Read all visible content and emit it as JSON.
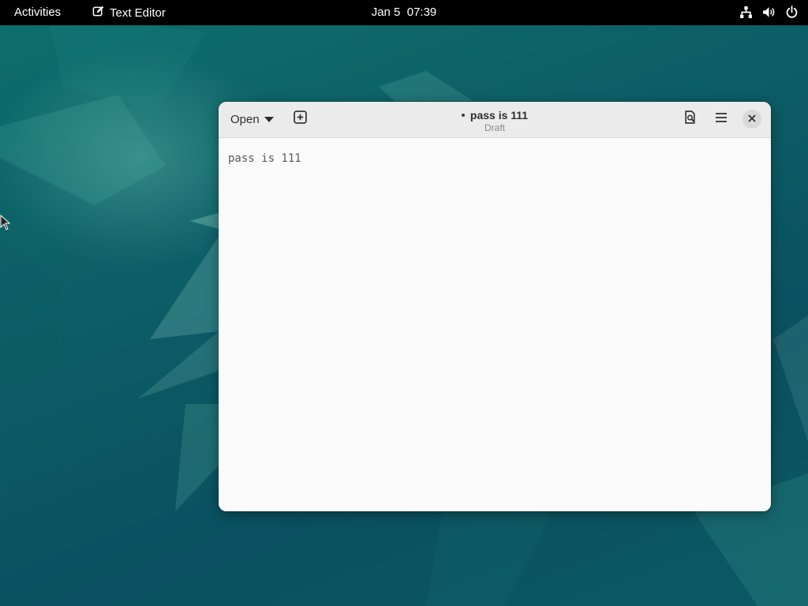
{
  "topbar": {
    "activities_label": "Activities",
    "app_name": "Text Editor",
    "clock": "Jan 5  07:39",
    "app_icon": "text-editor-icon",
    "status_icons": [
      "network-icon",
      "volume-icon",
      "power-icon"
    ]
  },
  "window": {
    "title": "pass is 111",
    "subtitle": "Draft",
    "unsaved_indicator": "•",
    "open_label": "Open",
    "icons": {
      "open_dropdown": "chevron-down-icon",
      "new_tab": "new-tab-icon",
      "search": "search-icon",
      "menu": "hamburger-menu-icon",
      "close": "close-icon"
    }
  },
  "editor": {
    "content": "pass is 111"
  },
  "colors": {
    "topbar_bg": "#000000",
    "headerbar_bg": "#ebebeb",
    "editor_bg": "#fafafa",
    "desktop_bg": "#0c5a63"
  }
}
